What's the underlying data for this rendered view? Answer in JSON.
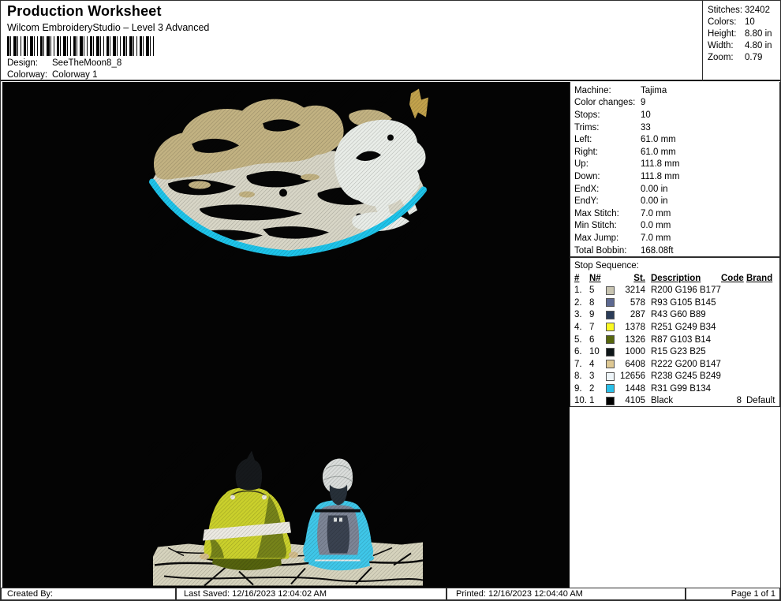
{
  "header": {
    "title": "Production Worksheet",
    "subtitle": "Wilcom EmbroideryStudio – Level 3 Advanced",
    "design_label": "Design:",
    "design_value": "SeeTheMoon8_8",
    "colorway_label": "Colorway:",
    "colorway_value": "Colorway 1",
    "stats": [
      {
        "label": "Stitches:",
        "value": "32402"
      },
      {
        "label": "Colors:",
        "value": "10"
      },
      {
        "label": "Height:",
        "value": "8.80 in"
      },
      {
        "label": "Width:",
        "value": "4.80 in"
      },
      {
        "label": "Zoom:",
        "value": "0.79"
      }
    ]
  },
  "machine_info": [
    {
      "label": "Machine:",
      "value": "Tajima"
    },
    {
      "label": "Color changes:",
      "value": "9"
    },
    {
      "label": "Stops:",
      "value": "10"
    },
    {
      "label": "Trims:",
      "value": "33"
    },
    {
      "label": "Left:",
      "value": "61.0 mm"
    },
    {
      "label": "Right:",
      "value": "61.0 mm"
    },
    {
      "label": "Up:",
      "value": "111.8 mm"
    },
    {
      "label": "Down:",
      "value": "111.8 mm"
    },
    {
      "label": "EndX:",
      "value": "0.00 in"
    },
    {
      "label": "EndY:",
      "value": "0.00 in"
    },
    {
      "label": "Max Stitch:",
      "value": "7.0 mm"
    },
    {
      "label": "Min Stitch:",
      "value": "0.0 mm"
    },
    {
      "label": "Max Jump:",
      "value": "7.0 mm"
    },
    {
      "label": "Total Bobbin:",
      "value": "168.08ft"
    }
  ],
  "stop_sequence": {
    "title": "Stop Sequence:",
    "columns": {
      "num": "#",
      "needle": "N#",
      "st": "St.",
      "description": "Description",
      "code": "Code",
      "brand": "Brand"
    },
    "rows": [
      {
        "num": "1.",
        "n": "5",
        "color": "#c8c4b1",
        "st": "3214",
        "description": "R200 G196 B177",
        "code": "",
        "brand": ""
      },
      {
        "num": "2.",
        "n": "8",
        "color": "#5d6991",
        "st": "578",
        "description": "R93 G105 B145",
        "code": "",
        "brand": ""
      },
      {
        "num": "3.",
        "n": "9",
        "color": "#2b3c59",
        "st": "287",
        "description": "R43 G60 B89",
        "code": "",
        "brand": ""
      },
      {
        "num": "4.",
        "n": "7",
        "color": "#fbf922",
        "st": "1378",
        "description": "R251 G249 B34",
        "code": "",
        "brand": ""
      },
      {
        "num": "5.",
        "n": "6",
        "color": "#57670e",
        "st": "1326",
        "description": "R87 G103 B14",
        "code": "",
        "brand": ""
      },
      {
        "num": "6.",
        "n": "10",
        "color": "#0f1719",
        "st": "1000",
        "description": "R15 G23 B25",
        "code": "",
        "brand": ""
      },
      {
        "num": "7.",
        "n": "4",
        "color": "#dec893",
        "st": "6408",
        "description": "R222 G200 B147",
        "code": "",
        "brand": ""
      },
      {
        "num": "8.",
        "n": "3",
        "color": "#eef5f9",
        "st": "12656",
        "description": "R238 G245 B249",
        "code": "",
        "brand": ""
      },
      {
        "num": "9.",
        "n": "2",
        "color": "#29bfe8",
        "st": "1448",
        "description": "R31 G99 B134",
        "code": "",
        "brand": ""
      },
      {
        "num": "10.",
        "n": "1",
        "color": "#000000",
        "st": "4105",
        "description": "Black",
        "code": "8",
        "brand": "Default"
      }
    ]
  },
  "footer": {
    "created_by": "Created By:",
    "last_saved": "Last Saved: 12/16/2023 12:04:02 AM",
    "printed": "Printed: 12/16/2023 12:04:40 AM",
    "page": "Page 1 of 1"
  },
  "design_preview": {
    "name": "SeeTheMoon8_8 embroidery preview",
    "colors": {
      "bg": "#040404",
      "moon_grey": "#d8d6c7",
      "moon_tan": "#c2b282",
      "moon_white": "#e9ede8",
      "moon_cyan": "#1ec4ea",
      "moon_gold": "#c2a24c",
      "ground": "#d6d3bd",
      "fig1_jacket": "#cad02c",
      "fig1_shade": "#76831a",
      "fig1_stripe": "#eceae2",
      "fig1_hair": "#16191c",
      "skin": "#d3bd8b",
      "fig2_cyan": "#3fc7e9",
      "fig2_vest": "#7d8596",
      "fig2_vest_dark": "#3a4250",
      "fig2_head": "#dadddb"
    }
  }
}
